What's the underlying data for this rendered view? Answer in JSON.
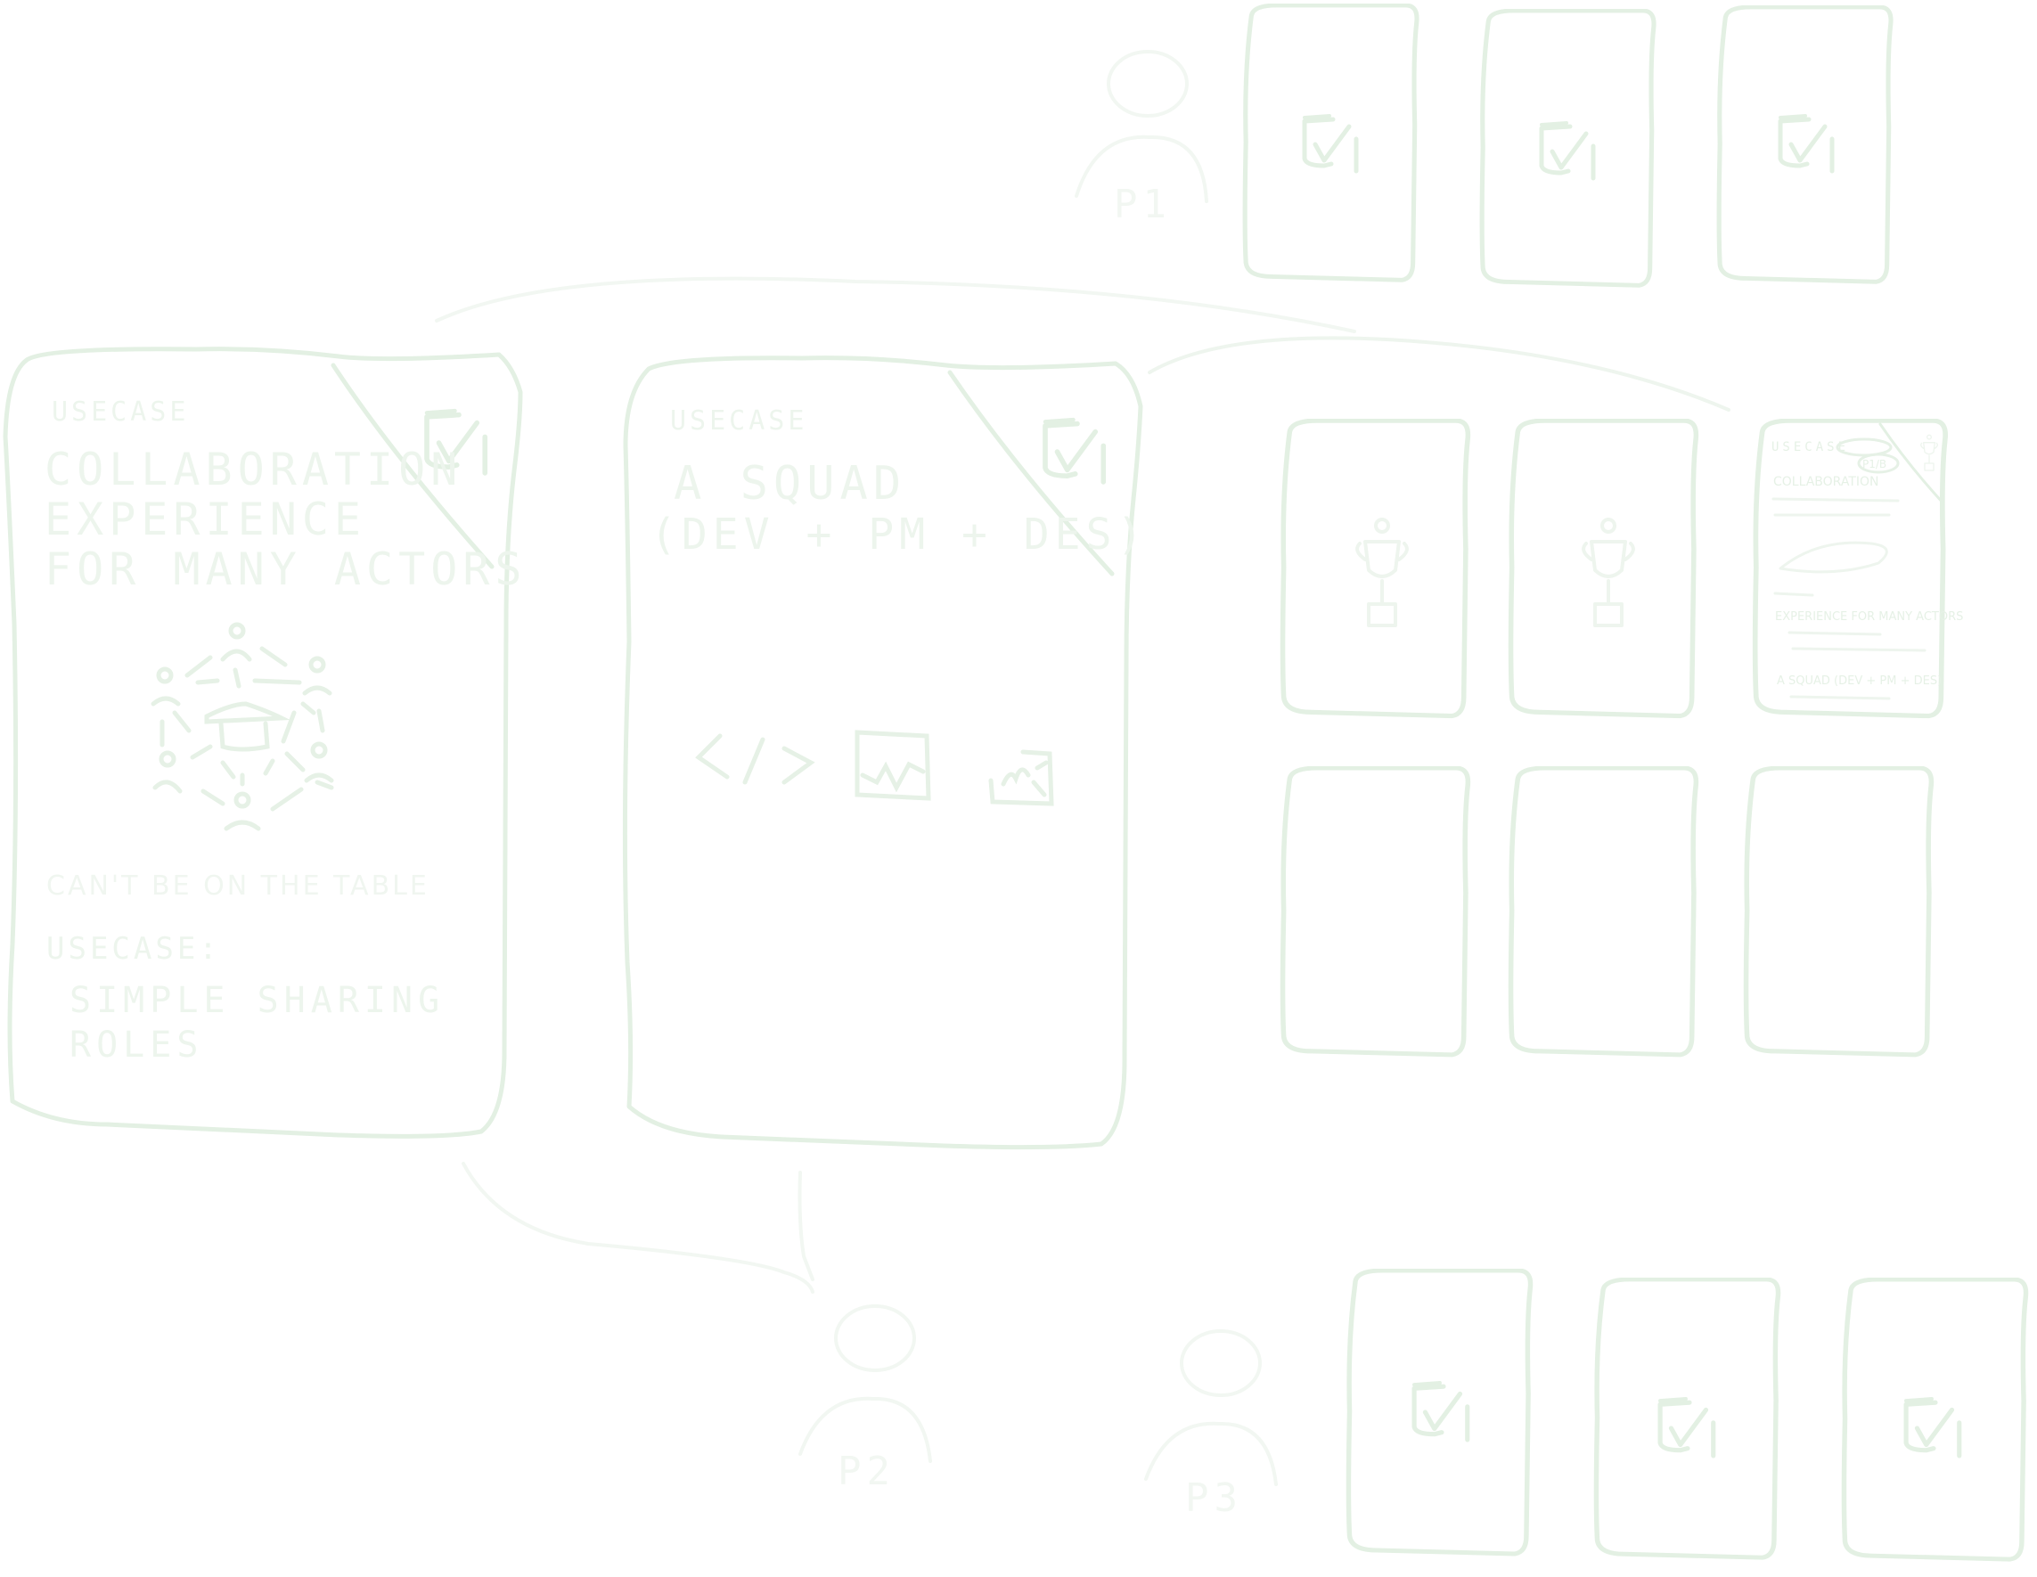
{
  "colors": {
    "card_stroke": "#e3f0e3",
    "faint_ink": "#eef5ee",
    "text_ink": "#edf5ed"
  },
  "cards": {
    "collaboration": {
      "label": "USECASE",
      "title_lines": [
        "COLLABORATION",
        "EXPERIENCE",
        "FOR MANY ACTORS"
      ],
      "note": "CAN'T BE ON THE TABLE",
      "note_emphasis": "ON THE TABLE",
      "sub_label": "USECASE:",
      "sub_lines": [
        "SIMPLE SHARING",
        "ROLES"
      ],
      "icon": "group-collaboration-icon",
      "corner_icon": "checkbox-checked-icon"
    },
    "squad": {
      "label": "USECASE",
      "title_lines": [
        "A SQUAD",
        "(DEV + PM + DES)"
      ],
      "icons": [
        "code-icon",
        "chart-icon",
        "sketch-icon"
      ],
      "corner_icon": "checkbox-checked-icon"
    },
    "mini_card": {
      "label": "USECASE",
      "pill": "P1/B",
      "icon": "trophy-icon",
      "lines": [
        "COLLABORATION",
        "EXPERIENCE FOR MANY ACTORS",
        "A SQUAD (DEV + PM + DES)"
      ]
    }
  },
  "personas": [
    {
      "id": "p1",
      "label": "P1"
    },
    {
      "id": "p2",
      "label": "P2"
    },
    {
      "id": "p3",
      "label": "P3"
    }
  ],
  "groups": {
    "top_checkbox_cards": 3,
    "trophy_cards": 2,
    "empty_cards": 3,
    "bottom_checkbox_cards": 3
  }
}
